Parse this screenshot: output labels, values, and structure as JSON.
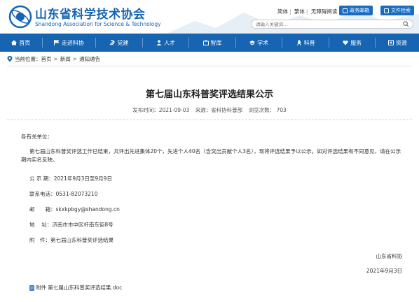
{
  "header": {
    "site_name": "山东省科学技术协会",
    "site_name_en": "Shandong Association for Science & Technology",
    "links": [
      "简体",
      "繁体",
      "无障碍阅读"
    ],
    "gov_service": "政务邮箱",
    "doc_center": "文件检索",
    "search_placeholder": "请输入关键词..."
  },
  "nav": {
    "items": [
      {
        "label": "首页",
        "icon": "home-icon"
      },
      {
        "label": "走进科协",
        "icon": "flag-icon"
      },
      {
        "label": "党建",
        "icon": "party-icon"
      },
      {
        "label": "人才",
        "icon": "people-icon"
      },
      {
        "label": "智库",
        "icon": "think-tank-icon"
      },
      {
        "label": "学术",
        "icon": "academic-cap-icon"
      },
      {
        "label": "科普",
        "icon": "rocket-icon"
      },
      {
        "label": "服务",
        "icon": "heart-icon"
      },
      {
        "label": "资源",
        "icon": "resource-icon"
      }
    ]
  },
  "breadcrumb": {
    "prefix": "当前位置：",
    "items": [
      "首页",
      "新闻",
      "通知通告"
    ]
  },
  "article": {
    "title": "第七届山东科普奖评选结果公示",
    "publish_time": "发布时间：2021-09-03",
    "source": "来源：省科协科普部",
    "views": "浏览次数： 703",
    "greeting": "各有关单位：",
    "body": "第七届山东科普奖评选工作已结束，共评出先进集体20个，先进个人40名（含突出贡献个人3名），现将评选结果予以公示。如对评选结果有不同意见，请在公示期内实名反映。",
    "period": "公 示 期：2021年9月3日至9月9日",
    "phone": "联系电话：0531-82073210",
    "email": "邮　　箱：skxkpbgy@shandong.cn",
    "address": "地　 址：济南市市中区杆南东街8号",
    "attachment_note": "附　件：第七届山东科普奖评选结果",
    "signature": "山东省科协",
    "date": "2021年9月3日",
    "attachment_link": "附件 第七届山东科普奖评选结果.doc"
  },
  "colors": {
    "brand_blue": "#1765b2",
    "nav_bg": "#1765b2"
  }
}
